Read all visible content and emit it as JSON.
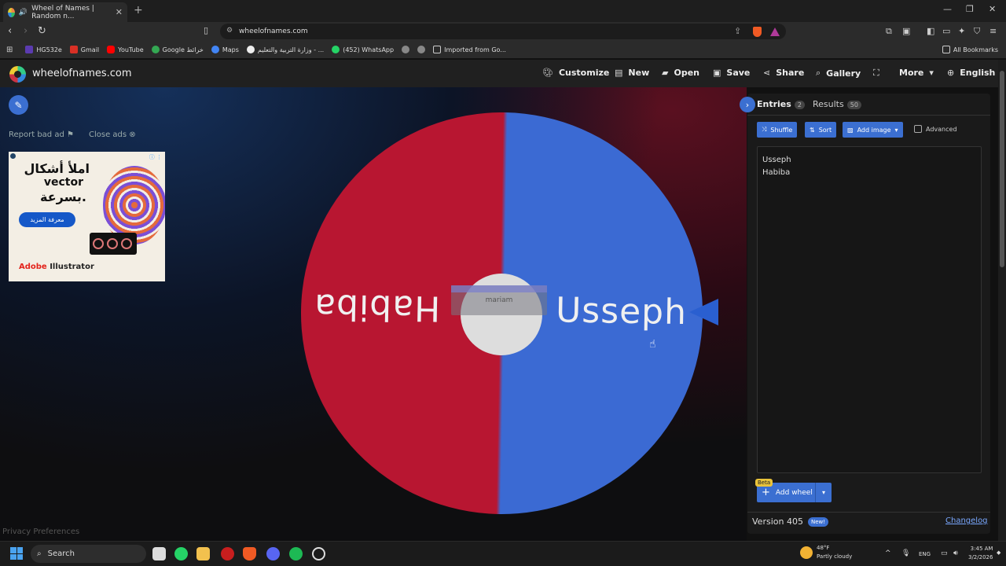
{
  "browser": {
    "tab_title": "Wheel of Names | Random n...",
    "new_tab": "+",
    "url": "wheelofnames.com",
    "bookmarks": [
      "HG532e",
      "Gmail",
      "YouTube",
      "Google خرائط",
      "Maps",
      "وزارة التربية والتعليم - ...",
      "(452) WhatsApp",
      "Imported from Go..."
    ],
    "all_bookmarks": "All Bookmarks"
  },
  "site": {
    "title": "wheelofnames.com",
    "nav": {
      "customize": "Customize",
      "new": "New",
      "open": "Open",
      "save": "Save",
      "share": "Share",
      "gallery": "Gallery",
      "more": "More",
      "language": "English"
    }
  },
  "ads": {
    "report": "Report bad ad",
    "close": "Close ads",
    "line1": "املأ أشكال",
    "line2": "vector",
    "line3": "بسرعة.",
    "cta": "معرفة المزيد",
    "brand_a": "Adobe",
    "brand_b": " Illustrator"
  },
  "wheel": {
    "segments": [
      {
        "name": "Usseph",
        "color": "#3b6ad3"
      },
      {
        "name": "Habiba",
        "color": "#b81631"
      }
    ],
    "hub_name": "mariam"
  },
  "panel": {
    "tab_entries": "Entries",
    "entries_count": "2",
    "tab_results": "Results",
    "results_count": "50",
    "shuffle": "Shuffle",
    "sort": "Sort",
    "add_image": "Add image",
    "advanced": "Advanced",
    "entries": [
      "Usseph",
      "Habiba"
    ],
    "beta": "Beta",
    "add_wheel": "Add wheel",
    "version": "Version 405",
    "new_badge": "New!",
    "changelog": "Changelog"
  },
  "footer": {
    "privacy": "Privacy Preferences"
  },
  "taskbar": {
    "search": "Search",
    "weather_temp": "48°F",
    "weather_desc": "Partly cloudy",
    "lang": "ENG",
    "time": "3:45 AM",
    "date": "3/2/2026"
  }
}
